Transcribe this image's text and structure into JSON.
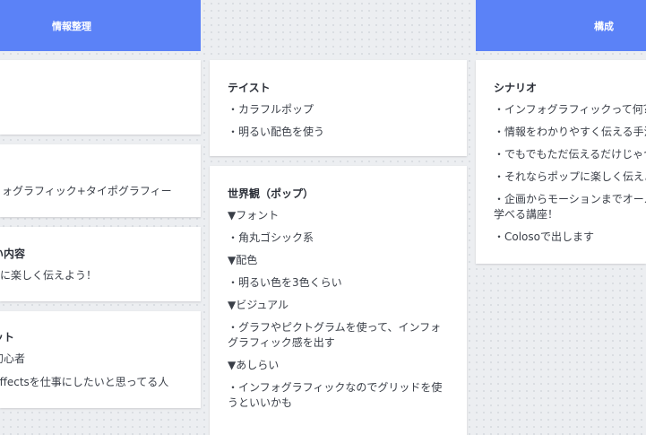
{
  "columns": {
    "left": {
      "header": "情報整理"
    },
    "right": {
      "header": "構成"
    }
  },
  "left_cards": {
    "card2": {
      "text": "ォグラフィック+タイポグラフィー"
    },
    "card3": {
      "title": "い内容",
      "text": "ずに楽しく伝えよう！"
    },
    "card4": {
      "title": "ット",
      "line1": "初心者",
      "line2": "Effectsを仕事にしたいと思ってる人"
    }
  },
  "middle_cards": {
    "taste": {
      "title": "テイスト",
      "items": [
        "・カラフルポップ",
        "・明るい配色を使う"
      ]
    },
    "worldview": {
      "title": "世界観（ポップ）",
      "items": [
        "▼フォント",
        "・角丸ゴシック系",
        "▼配色",
        "・明るい色を3色くらい",
        "▼ビジュアル",
        "・グラフやピクトグラムを使って、インフォグラフィック感を出す",
        "▼あしらい",
        "・インフォグラフィックなのでグリッドを使うといいかも"
      ]
    }
  },
  "right_cards": {
    "scenario": {
      "title": "シナリオ",
      "items": [
        "・インフォグラフィックって何？",
        "・情報をわかりやすく伝える手法",
        "・でもでもただ伝えるだけじゃつ",
        "・それならポップに楽しく伝えよ",
        "・企画からモーションまでオール",
        "学べる講座！",
        "・Colosoで出します"
      ]
    }
  }
}
